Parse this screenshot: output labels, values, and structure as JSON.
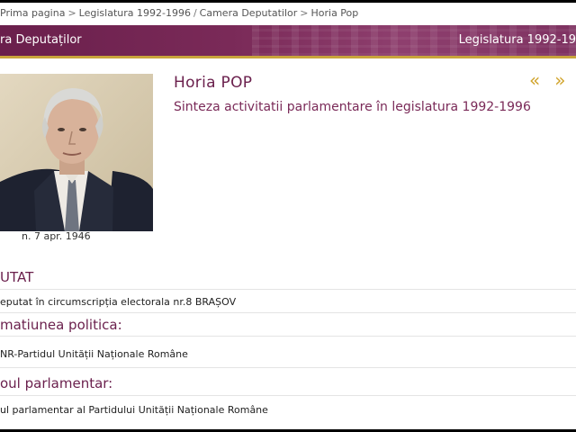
{
  "breadcrumb": {
    "items": [
      "Prima pagina",
      "Legislatura 1992-1996",
      "Camera Deputatilor",
      "Horia Pop"
    ]
  },
  "banner": {
    "left_text": "ra Deputaților",
    "right_text": "Legislatura 1992-19"
  },
  "profile": {
    "name": "Horia POP",
    "subtitle": "Sinteza activitatii parlamentare în legislatura 1992-1996",
    "birth": "n. 7 apr. 1946",
    "nav_prev": "«",
    "nav_next": "»"
  },
  "sections": {
    "deputat_title": "UTAT",
    "deputat_text": "eputat în circumscripția electorala nr.8 BRAȘOV",
    "formatiune_title": "matiunea politica:",
    "formatiune_text": "NR-Partidul Unității Naționale Române",
    "grup_title": "oul parlamentar:",
    "grup_text": "ul parlamentar al Partidului Unității Naționale Române"
  },
  "colors": {
    "brand": "#6a1f4c",
    "accent_gold": "#d1a42c"
  }
}
